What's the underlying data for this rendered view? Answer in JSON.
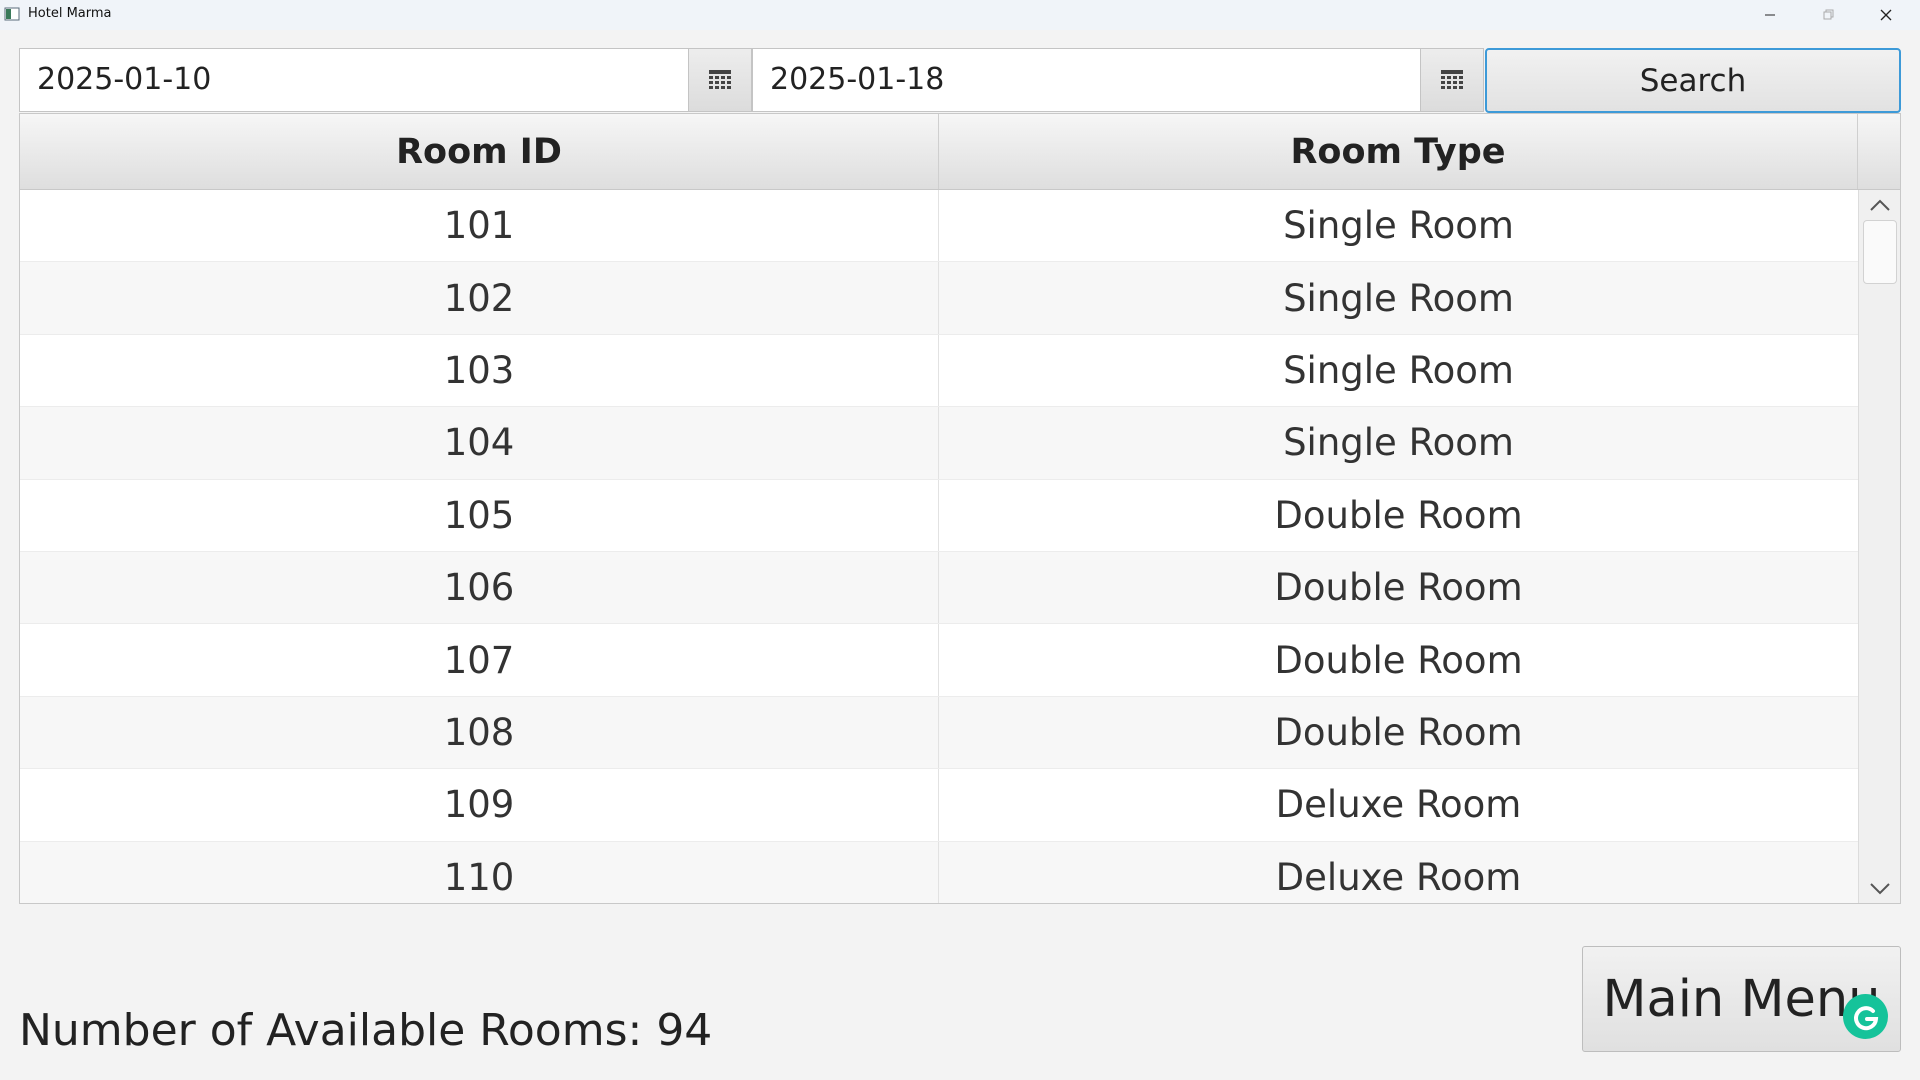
{
  "window": {
    "title": "Hotel Marma"
  },
  "search": {
    "start_date": "2025-01-10",
    "end_date": "2025-01-18",
    "search_label": "Search"
  },
  "table": {
    "columns": [
      "Room ID",
      "Room Type"
    ],
    "rows": [
      [
        "101",
        "Single Room"
      ],
      [
        "102",
        "Single Room"
      ],
      [
        "103",
        "Single Room"
      ],
      [
        "104",
        "Single Room"
      ],
      [
        "105",
        "Double Room"
      ],
      [
        "106",
        "Double Room"
      ],
      [
        "107",
        "Double Room"
      ],
      [
        "108",
        "Double Room"
      ],
      [
        "109",
        "Deluxe Room"
      ],
      [
        "110",
        "Deluxe Room"
      ]
    ]
  },
  "footer": {
    "available_label": "Number of Available Rooms: 94",
    "main_menu_label": "Main Menu"
  },
  "colors": {
    "focus_border": "#3d9ad8",
    "grammarly": "#15c39a"
  },
  "icons": {
    "date_picker": "calendar-icon",
    "assistant": "grammarly-icon"
  }
}
